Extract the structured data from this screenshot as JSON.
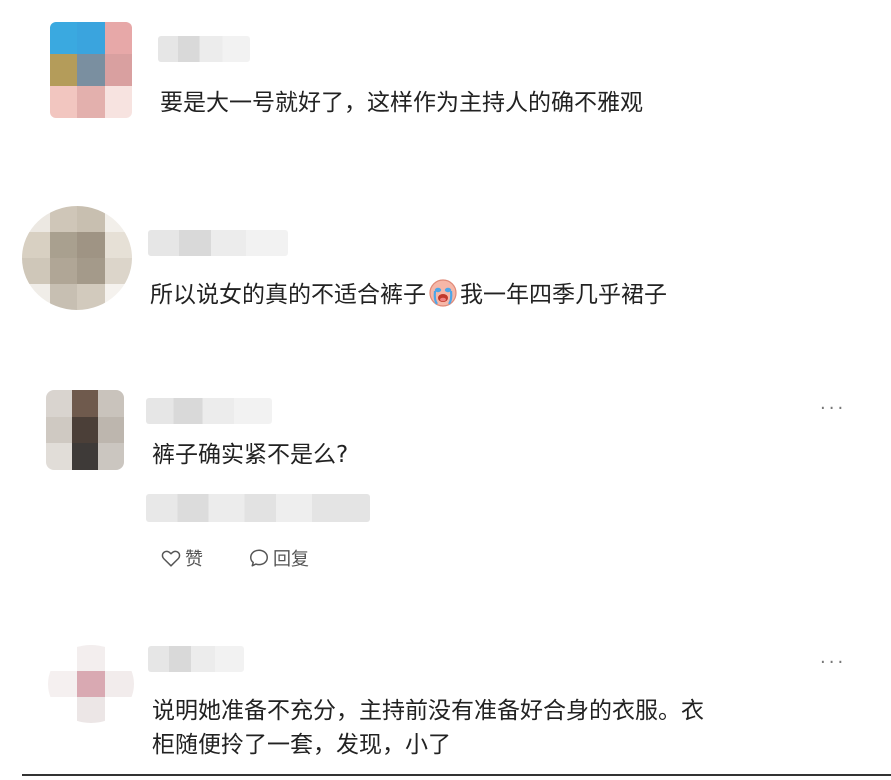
{
  "comments": [
    {
      "text": "要是大一号就好了，这样作为主持人的确不雅观"
    },
    {
      "text_before": "所以说女的真的不适合裤子",
      "emoji": "crying-face-emoji",
      "text_after": "我一年四季几乎裙子"
    },
    {
      "text": "裤子确实紧不是么?",
      "like_label": "赞",
      "reply_label": "回复",
      "more": "···"
    },
    {
      "text": "说明她准备不充分，主持前没有准备好合身的衣服。衣\n柜随便拎了一套，发现，小了",
      "more": "···"
    }
  ],
  "icons": {
    "like": "heart-outline-icon",
    "reply": "speech-bubble-icon",
    "more": "more-dots-icon"
  },
  "colors": {
    "text": "#222222",
    "action_text": "#555555",
    "more_dots": "#777777"
  }
}
